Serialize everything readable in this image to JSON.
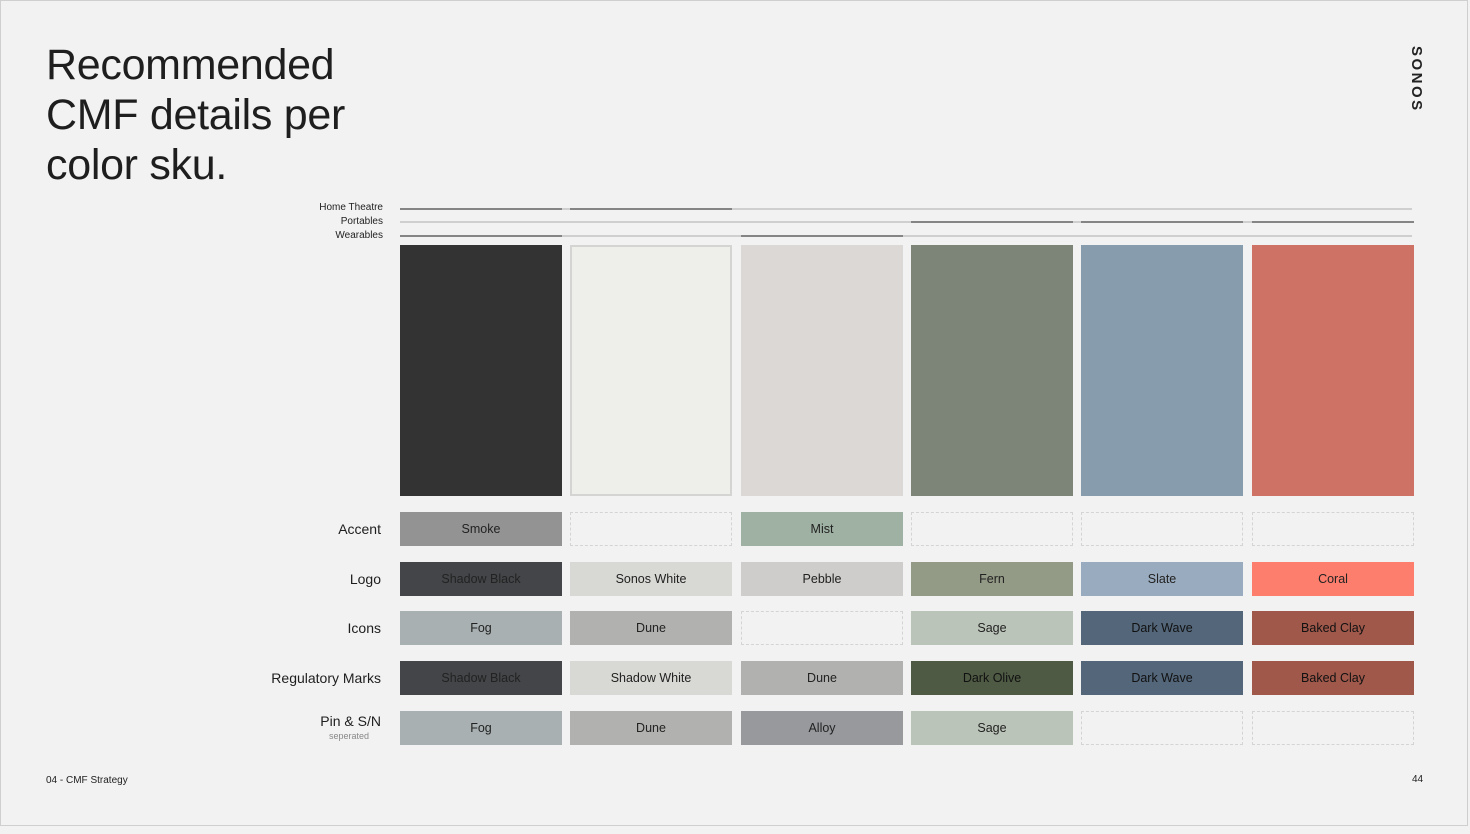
{
  "title": "Recommended CMF details per color sku.",
  "title_lines": [
    "Recommended",
    "CMF details per",
    "color sku."
  ],
  "brand": "SONOS",
  "categories": [
    {
      "label": "Home Theatre",
      "active_columns": [
        0,
        1
      ]
    },
    {
      "label": "Portables",
      "active_columns": [
        3,
        4,
        5
      ]
    },
    {
      "label": "Wearables",
      "active_columns": [
        0,
        2
      ]
    }
  ],
  "columns": [
    {
      "swatch_color": "#333333"
    },
    {
      "swatch_color": "#eeeeeb",
      "swatch_border": "#d4d4d2"
    },
    {
      "swatch_color": "#dbd8d5"
    },
    {
      "swatch_color": "#7c8577"
    },
    {
      "swatch_color": "#879dad"
    },
    {
      "swatch_color": "#cd7264"
    }
  ],
  "rows": [
    {
      "label": "Accent",
      "sublabel": "",
      "cells": [
        {
          "text": "Smoke",
          "bg": "#939393",
          "fg": "#222222"
        },
        null,
        {
          "text": "Mist",
          "bg": "#9fb1a3",
          "fg": "#222222"
        },
        null,
        null,
        null
      ]
    },
    {
      "label": "Logo",
      "sublabel": "",
      "cells": [
        {
          "text": "Shadow Black",
          "bg": "#434548",
          "fg": "#222222"
        },
        {
          "text": "Sonos White",
          "bg": "#d8d8d4",
          "fg": "#222222"
        },
        {
          "text": "Pebble",
          "bg": "#cecdcb",
          "fg": "#222222"
        },
        {
          "text": "Fern",
          "bg": "#939a85",
          "fg": "#222222"
        },
        {
          "text": "Slate",
          "bg": "#99abbe",
          "fg": "#222222"
        },
        {
          "text": "Coral",
          "bg": "#fd7e6d",
          "fg": "#222222"
        }
      ]
    },
    {
      "label": "Icons",
      "sublabel": "",
      "cells": [
        {
          "text": "Fog",
          "bg": "#a8b0b1",
          "fg": "#222222"
        },
        {
          "text": "Dune",
          "bg": "#b1b1b0",
          "fg": "#222222"
        },
        null,
        {
          "text": "Sage",
          "bg": "#bbc4b8",
          "fg": "#222222"
        },
        {
          "text": "Dark Wave",
          "bg": "#53667a",
          "fg": "#111111"
        },
        {
          "text": "Baked Clay",
          "bg": "#a0584b",
          "fg": "#111111"
        }
      ]
    },
    {
      "label": "Regulatory Marks",
      "sublabel": "",
      "cells": [
        {
          "text": "Shadow Black",
          "bg": "#434548",
          "fg": "#222222"
        },
        {
          "text": "Shadow White",
          "bg": "#d8d8d4",
          "fg": "#222222"
        },
        {
          "text": "Dune",
          "bg": "#b1b1b0",
          "fg": "#222222"
        },
        {
          "text": "Dark Olive",
          "bg": "#4e5a43",
          "fg": "#111111"
        },
        {
          "text": "Dark Wave",
          "bg": "#53667a",
          "fg": "#111111"
        },
        {
          "text": "Baked Clay",
          "bg": "#a0584b",
          "fg": "#111111"
        }
      ]
    },
    {
      "label": "Pin & S/N",
      "sublabel": "seperated",
      "cells": [
        {
          "text": "Fog",
          "bg": "#a8b0b1",
          "fg": "#222222"
        },
        {
          "text": "Dune",
          "bg": "#b1b1b0",
          "fg": "#222222"
        },
        {
          "text": "Alloy",
          "bg": "#98999d",
          "fg": "#222222"
        },
        {
          "text": "Sage",
          "bg": "#bbc4b8",
          "fg": "#222222"
        },
        null,
        null
      ]
    }
  ],
  "footer": {
    "section": "04 - CMF Strategy",
    "page": "44"
  }
}
